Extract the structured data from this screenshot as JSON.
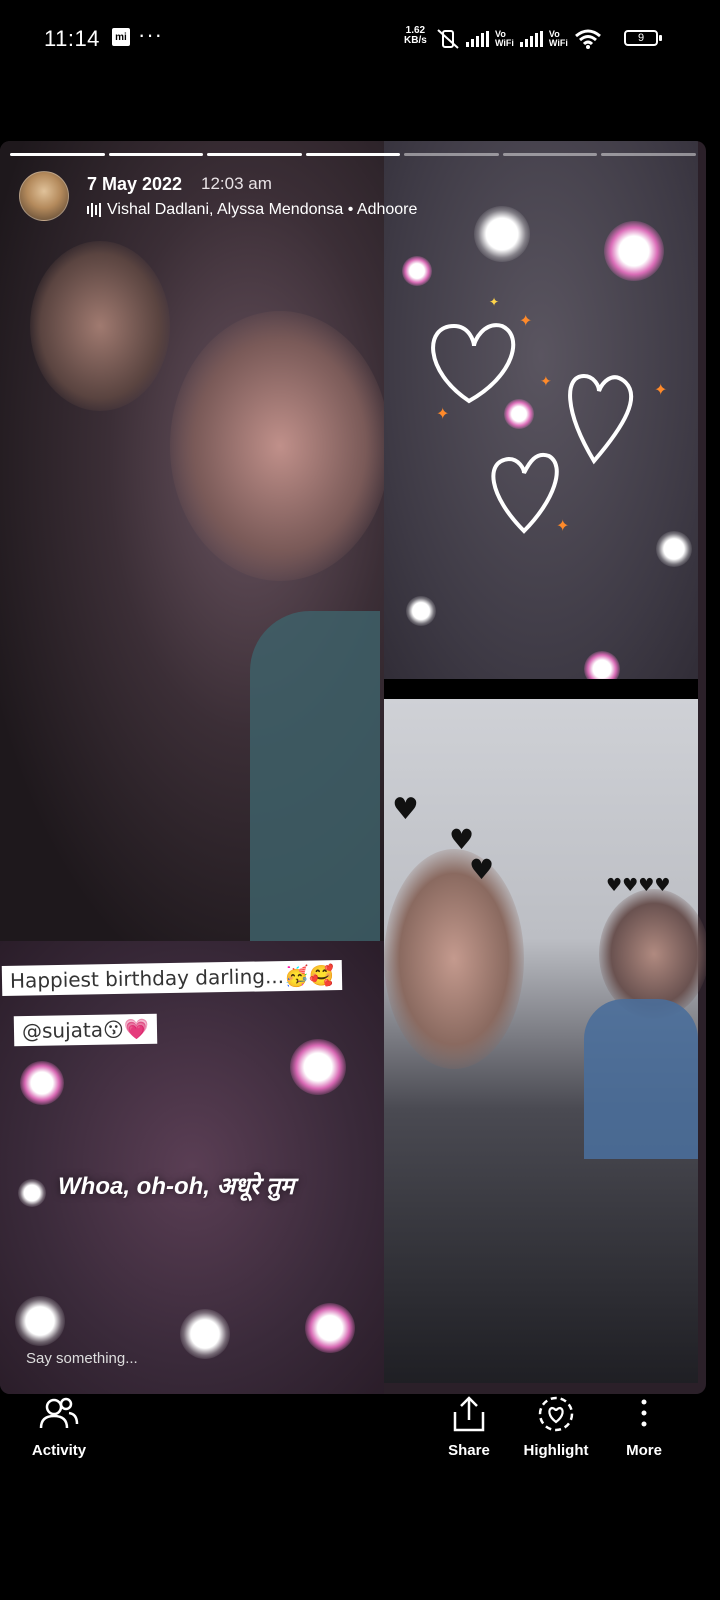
{
  "status_bar": {
    "time": "11:14",
    "net_speed_value": "1.62",
    "net_speed_unit": "KB/s",
    "vowifi_1": "Vo\nWiFi",
    "vowifi_2": "Vo\nWiFi",
    "battery": "9"
  },
  "story": {
    "progress_segments": 7,
    "progress_done": 4,
    "date": "7 May 2022",
    "time": "12:03 am",
    "music": "Vishal Dadlani, Alyssa Mendonsa • Adhoore",
    "caption_1": "Happiest birthday darling...🥳🥰",
    "caption_2": "@sujata😗💗",
    "lyric": "Whoa, oh-oh, अधूरे तुम",
    "reply_placeholder": "Say something..."
  },
  "bottom_bar": {
    "activity": "Activity",
    "share": "Share",
    "highlight": "Highlight",
    "more": "More"
  }
}
